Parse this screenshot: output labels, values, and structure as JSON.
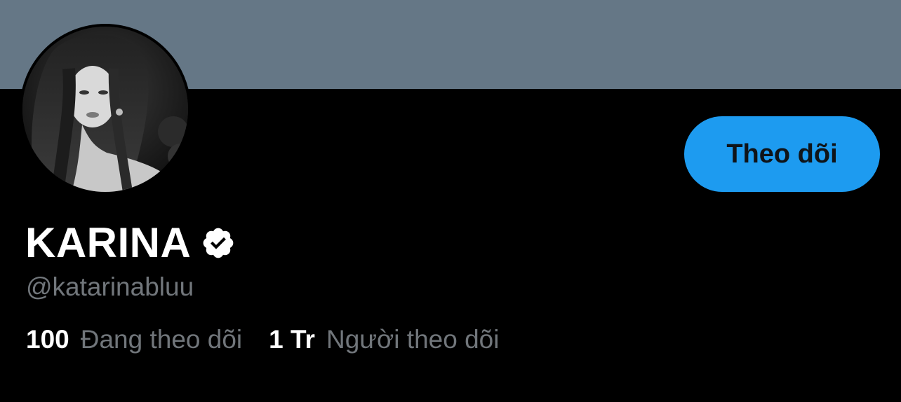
{
  "profile": {
    "display_name": "KARINA",
    "handle": "@katarinabluu",
    "verified_icon": "verified-badge-icon",
    "follow_label": "Theo dõi",
    "stats": {
      "following_count": "100",
      "following_label": "Đang theo dõi",
      "followers_count": "1 Tr",
      "followers_label": "Người theo dõi"
    }
  },
  "colors": {
    "banner": "#657786",
    "background": "#000000",
    "accent": "#1d9bf0",
    "secondary_text": "#71767b",
    "primary_text": "#ffffff"
  }
}
